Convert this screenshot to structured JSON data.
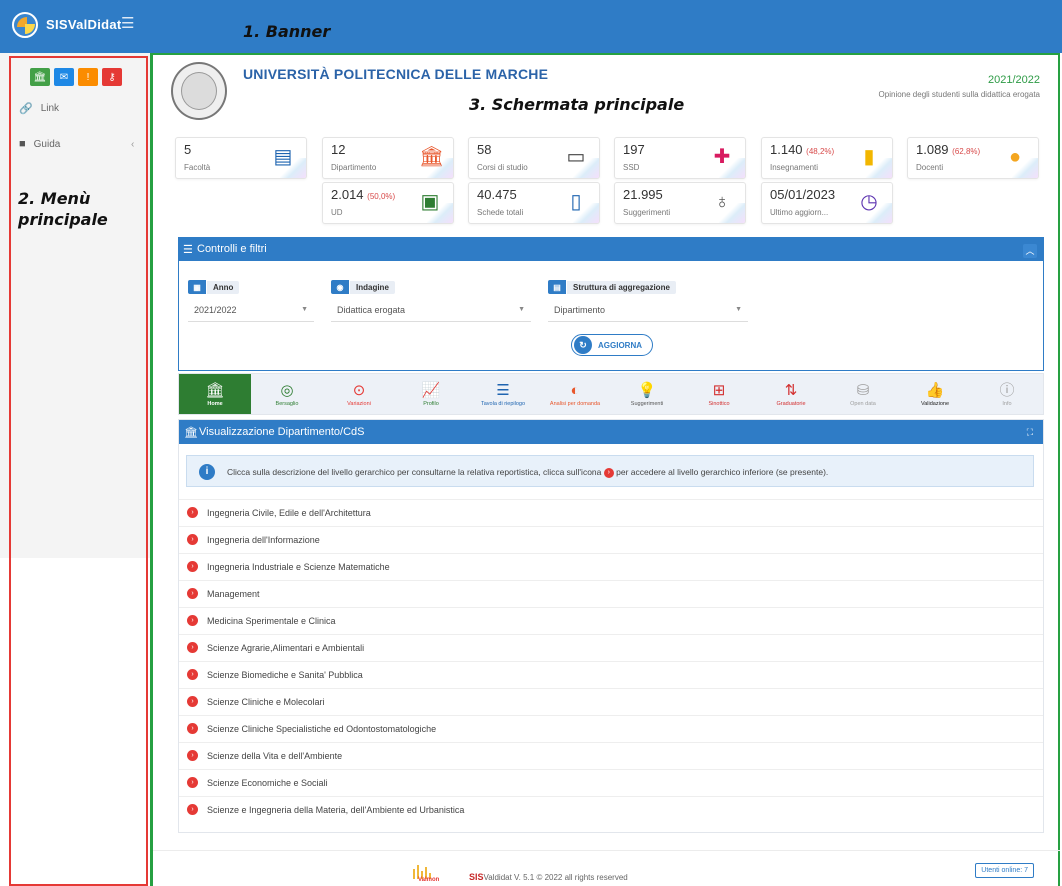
{
  "banner": {
    "brand": "SISValDidat",
    "annotation": "1. Banner"
  },
  "sidebar": {
    "annotation_line1": "2. Menù",
    "annotation_line2": "principale",
    "quick_buttons": [
      {
        "icon": "institution-icon",
        "color": "#43a047"
      },
      {
        "icon": "envelope-icon",
        "color": "#1e88e5"
      },
      {
        "icon": "info-icon",
        "color": "#fb8c00"
      },
      {
        "icon": "key-icon",
        "color": "#e53935"
      }
    ],
    "items": [
      {
        "label": "Link"
      },
      {
        "label": "Guida"
      }
    ]
  },
  "header": {
    "title": "UNIVERSITÀ POLITECNICA DELLE MARCHE",
    "year": "2021/2022",
    "subtitle": "Opinione degli studenti sulla didattica erogata",
    "annotation": "3. Schermata principale"
  },
  "stats": [
    {
      "value": "5",
      "pct": "",
      "label": "Facoltà",
      "icon": "building-icon",
      "color": "#1e64b0"
    },
    {
      "value": "12",
      "pct": "",
      "label": "Dipartimento",
      "icon": "department-icon",
      "color": "#e8572c"
    },
    {
      "value": "58",
      "pct": "",
      "label": "Corsi di studio",
      "icon": "presentation-icon",
      "color": "#444"
    },
    {
      "value": "197",
      "pct": "",
      "label": "SSD",
      "icon": "puzzle-icon",
      "color": "#d81b60"
    },
    {
      "value": "1.140",
      "pct": "(48,2%)",
      "label": "Insegnamenti",
      "icon": "book-icon",
      "color": "#f2b600"
    },
    {
      "value": "1.089",
      "pct": "(62,8%)",
      "label": "Docenti",
      "icon": "users-icon",
      "color": "#f4a620"
    },
    {
      "value": "2.014",
      "pct": "(50,0%)",
      "label": "UD",
      "icon": "contact-card-icon",
      "color": "#2e7d32"
    },
    {
      "value": "40.475",
      "pct": "",
      "label": "Schede totali",
      "icon": "document-icon",
      "color": "#1e64b0"
    },
    {
      "value": "21.995",
      "pct": "",
      "label": "Suggerimenti",
      "icon": "lightbulb-icon",
      "color": "#555"
    },
    {
      "value": "05/01/2023",
      "pct": "",
      "label": "Ultimo aggiorn...",
      "icon": "clock-icon",
      "color": "#5e35b1"
    }
  ],
  "filters": {
    "title": "Controlli e filtri",
    "anno": {
      "label": "Anno",
      "value": "2021/2022"
    },
    "indagine": {
      "label": "Indagine",
      "value": "Didattica erogata"
    },
    "struttura": {
      "label": "Struttura di aggregazione",
      "value": "Dipartimento"
    },
    "refresh_label": "AGGIORNA"
  },
  "tabs": [
    {
      "label": "Home",
      "glyph": "🏛",
      "color": "#ffffff",
      "active": true
    },
    {
      "label": "Bersaglio",
      "glyph": "◎",
      "color": "#2e7d32"
    },
    {
      "label": "Variazioni",
      "glyph": "⊙",
      "color": "#e53935"
    },
    {
      "label": "Profilo",
      "glyph": "📈",
      "color": "#2e7d32"
    },
    {
      "label": "Tavola di riepilogo",
      "glyph": "☰",
      "color": "#1e64b0"
    },
    {
      "label": "Analisi per domanda",
      "glyph": "◐",
      "color": "#e8572c"
    },
    {
      "label": "Suggerimenti",
      "glyph": "💡",
      "color": "#555"
    },
    {
      "label": "Sinottico",
      "glyph": "⊞",
      "color": "#d32f2f"
    },
    {
      "label": "Graduatorie",
      "glyph": "⇅",
      "color": "#d32f2f"
    },
    {
      "label": "Open data",
      "glyph": "⛁",
      "color": "#9e9e9e"
    },
    {
      "label": "Validazione",
      "glyph": "👍",
      "color": "#222"
    },
    {
      "label": "Info",
      "glyph": "ⓘ",
      "color": "#9e9e9e"
    }
  ],
  "visual": {
    "title": "Visualizzazione Dipartimento/CdS",
    "info_part1": "Clicca sulla descrizione del livello gerarchico per consultarne la relativa reportistica, clicca sull'icona",
    "info_part2": "per accedere al livello gerarchico inferiore (se presente).",
    "departments": [
      "Ingegneria Civile, Edile e dell'Architettura",
      "Ingegneria dell'Informazione",
      "Ingegneria Industriale e Scienze Matematiche",
      "Management",
      "Medicina Sperimentale e Clinica",
      "Scienze Agrarie,Alimentari e Ambientali",
      "Scienze Biomediche e Sanita' Pubblica",
      "Scienze Cliniche e Molecolari",
      "Scienze Cliniche Specialistiche ed Odontostomatologiche",
      "Scienze della Vita e dell'Ambiente",
      "Scienze Economiche e Sociali",
      "Scienze e Ingegneria della Materia, dell'Ambiente ed Urbanistica"
    ]
  },
  "footer": {
    "logo_text": "Valmon",
    "brand": "SIS",
    "text": "Valdidat  V. 5.1  © 2022 all rights reserved",
    "online": "Utenti online: 7"
  }
}
